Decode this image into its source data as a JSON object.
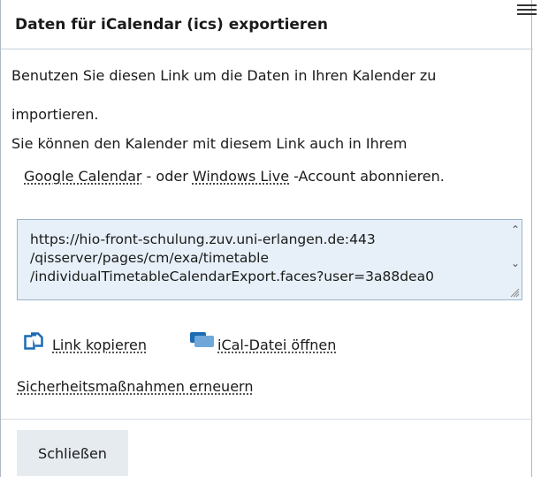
{
  "dialog": {
    "title": "Daten für iCalendar (ics) exportieren",
    "menu_icon": "hamburger-menu-icon"
  },
  "description": {
    "line1": "Benutzen Sie diesen Link um die Daten in Ihren Kalender zu",
    "line2": "importieren.",
    "line3": "Sie können den Kalender mit diesem Link auch in Ihrem",
    "google_link": "Google Calendar",
    "connector": " - oder ",
    "windows_link": "Windows Live",
    "suffix": " -Account abonnieren."
  },
  "export_url": {
    "line1": "https://hio-front-schulung.zuv.uni-erlangen.de:443",
    "line2": "/qisserver/pages/cm/exa/timetable",
    "line3": "/individualTimetableCalendarExport.faces?user=3a88dea0"
  },
  "actions": {
    "copy_label": "Link kopieren",
    "copy_icon": "copy-icon",
    "ical_label": "iCal-Datei öffnen",
    "ical_icon": "calendar-file-icon",
    "security_label": "Sicherheitsmaßnahmen erneuern"
  },
  "footer": {
    "close_label": "Schließen"
  },
  "colors": {
    "textarea_bg": "#e7f0f8",
    "icon_blue": "#1c6bb5",
    "icon_light_blue": "#6fa8d8",
    "button_bg": "#e6ebf0"
  }
}
